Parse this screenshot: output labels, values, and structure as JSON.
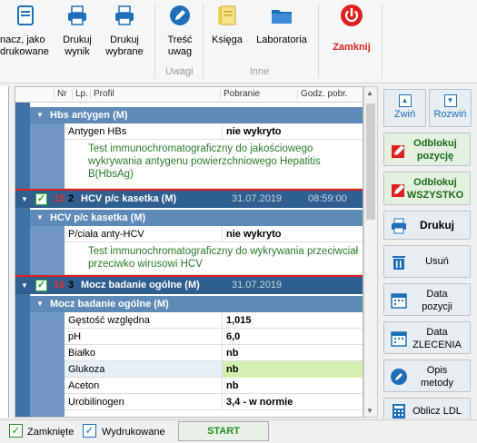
{
  "ribbon": {
    "mark_label_1": "nacz, jako",
    "mark_label_2": "drukowane",
    "print_result_1": "Drukuj",
    "print_result_2": "wynik",
    "print_selected_1": "Drukuj",
    "print_selected_2": "wybrane",
    "notes_content_1": "Treść",
    "notes_content_2": "uwag",
    "group_notes": "Uwagi",
    "book": "Księga",
    "laboratories": "Laboratoria",
    "group_other": "Inne",
    "close": "Zamknij"
  },
  "grid": {
    "headers": [
      "Nr",
      "Lp.",
      "Profil",
      "Pobranie",
      "Godz. pobr."
    ]
  },
  "entries": [
    {
      "sub_title": "Hbs antygen (M)",
      "results": [
        {
          "name": "Antygen HBs",
          "value": "nie wykryto"
        }
      ],
      "description": "Test immunochromatograficzny do jakościowego wykrywania antygenu powierzchniowego Hepatitis B(HbsAg)"
    },
    {
      "nr": "15",
      "lp": "2",
      "profile": "HCV p/c kasetka (M)",
      "date": "31.07.2019",
      "time": "08:59:00",
      "sub_title": "HCV p/c kasetka (M)",
      "results": [
        {
          "name": "P/ciała anty-HCV",
          "value": "nie wykryto"
        }
      ],
      "description": "Test immunochromatograficzny do  wykrywania przeciwciał przeciwko wirusowi HCV"
    },
    {
      "nr": "16",
      "lp": "3",
      "profile": "Mocz badanie ogólne (M)",
      "date": "31.07.2019",
      "sub_title": "Mocz badanie ogólne (M)",
      "results": [
        {
          "name": "Gęstość względna",
          "value": "1,015"
        },
        {
          "name": "pH",
          "value": "6,0"
        },
        {
          "name": "Białko",
          "value": "nb"
        },
        {
          "name": "Glukoza",
          "value": "nb"
        },
        {
          "name": "Aceton",
          "value": "nb"
        },
        {
          "name": "Urobilinogen",
          "value": "3,4 - w normie"
        }
      ]
    }
  ],
  "side": {
    "collapse": "Zwiń",
    "expand": "Rozwiń",
    "unlock_pos_1": "Odblokuj",
    "unlock_pos_2": "pozycję",
    "unlock_all_1": "Odblokuj",
    "unlock_all_2": "WSZYSTKO",
    "print": "Drukuj",
    "delete": "Usuń",
    "date_pos_1": "Data",
    "date_pos_2": "pozycji",
    "date_order_1": "Data",
    "date_order_2": "ZLECENIA",
    "method_1": "Opis",
    "method_2": "metody",
    "ldl": "Oblicz LDL"
  },
  "status": {
    "closed": "Zamknięte",
    "printed": "Wydrukowane",
    "start": "START"
  },
  "colors": {
    "accent": "#2f5f8e",
    "sub_header": "#5e8ab8",
    "highlight": "#d4f0b0",
    "close_red": "#e02020"
  }
}
